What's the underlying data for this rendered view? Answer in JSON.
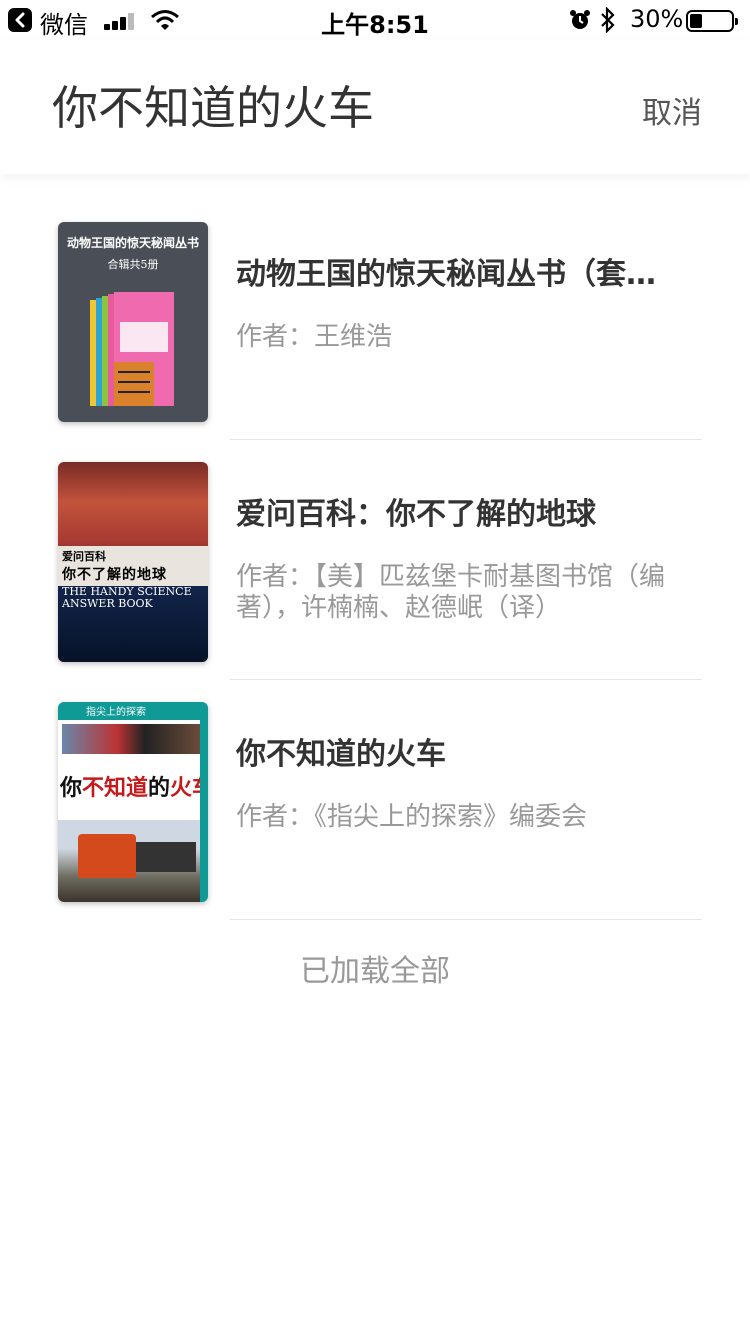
{
  "status_bar": {
    "back_app": "微信",
    "time": "上午8:51",
    "battery": "30%",
    "battery_level": 0.3
  },
  "search": {
    "query": "你不知道的火车",
    "cancel_label": "取消"
  },
  "results": [
    {
      "title": "动物王国的惊天秘闻丛书（套…",
      "author_label": "作者：",
      "author": "王维浩",
      "cover": {
        "line1": "动物王国的惊天秘闻丛书",
        "line2": "合辑共5册"
      }
    },
    {
      "title": "爱问百科：你不了解的地球",
      "author_label": "作者：",
      "author": "【美】匹兹堡卡耐基图书馆（编著），许楠楠、赵德岷（译）",
      "cover": {
        "line1": "爱问百科",
        "line2": "你不了解的地球",
        "line3": "THE HANDY SCIENCE ANSWER BOOK"
      }
    },
    {
      "title": "你不知道的火车",
      "author_label": "作者：",
      "author": "《指尖上的探索》编委会",
      "cover": {
        "line1": "指尖上的探索",
        "title_a": "你",
        "title_b": "不知道",
        "title_c": "的",
        "title_d": "火车"
      }
    }
  ],
  "footer": {
    "loaded_all": "已加载全部"
  }
}
